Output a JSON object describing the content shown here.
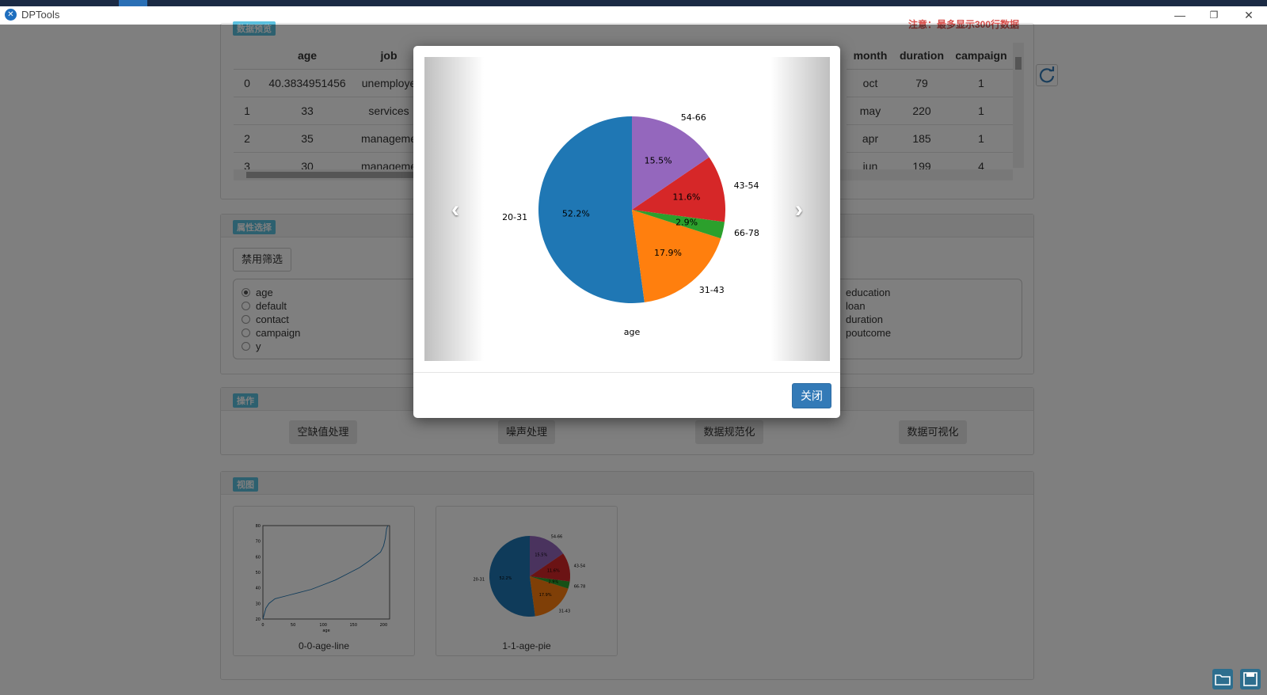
{
  "window": {
    "title": "DPTools",
    "minimize": "—",
    "restore": "❐",
    "close": "✕"
  },
  "table_panel": {
    "tag": "数据预览",
    "note": "注意：最多显示300行数据",
    "left_columns": [
      "",
      "age",
      "job"
    ],
    "right_columns": [
      "month",
      "duration",
      "campaign"
    ],
    "rows": [
      {
        "idx": "0",
        "age": "40.3834951456",
        "job": "unemploye",
        "month": "oct",
        "duration": "79",
        "campaign": "1"
      },
      {
        "idx": "1",
        "age": "33",
        "job": "services",
        "month": "may",
        "duration": "220",
        "campaign": "1"
      },
      {
        "idx": "2",
        "age": "35",
        "job": "manageme",
        "month": "apr",
        "duration": "185",
        "campaign": "1"
      },
      {
        "idx": "3",
        "age": "30",
        "job": "manageme",
        "month": "jun",
        "duration": "199",
        "campaign": "4"
      }
    ]
  },
  "attr_panel": {
    "tag": "属性选择",
    "filter_button": "禁用筛选",
    "left_options": [
      "age",
      "default",
      "contact",
      "campaign",
      "y"
    ],
    "right_options": [
      "education",
      "loan",
      "duration",
      "poutcome"
    ],
    "selected": "age"
  },
  "ops_panel": {
    "tag": "操作",
    "buttons": [
      "空缺值处理",
      "噪声处理",
      "数据规范化",
      "数据可视化"
    ]
  },
  "view_panel": {
    "tag": "视图",
    "thumbs": [
      {
        "caption": "0-0-age-line"
      },
      {
        "caption": "1-1-age-pie"
      }
    ]
  },
  "modal": {
    "close_label": "关闭",
    "prev_icon": "chevron-left-icon",
    "next_icon": "chevron-right-icon"
  },
  "chart_data": [
    {
      "type": "pie",
      "title": "",
      "xlabel": "age",
      "categories": [
        "20-31",
        "31-43",
        "66-78",
        "43-54",
        "54-66"
      ],
      "values": [
        52.2,
        17.9,
        2.9,
        11.6,
        15.5
      ],
      "labels": [
        "52.2%",
        "17.9%",
        "2.9%",
        "11.6%",
        "15.5%"
      ],
      "colors": [
        "#1f77b4",
        "#ff7f0e",
        "#2ca02c",
        "#d62728",
        "#9467bd"
      ]
    },
    {
      "type": "line",
      "xlabel": "age",
      "xlim": [
        0,
        210
      ],
      "ylim": [
        20,
        80
      ],
      "xticks": [
        "0",
        "50",
        "100",
        "150",
        "200"
      ],
      "yticks": [
        "20",
        "30",
        "40",
        "50",
        "60",
        "70",
        "80"
      ],
      "x": [
        0,
        5,
        10,
        20,
        40,
        60,
        80,
        100,
        120,
        140,
        160,
        175,
        185,
        195,
        200,
        203,
        205,
        207
      ],
      "y": [
        20,
        27,
        30,
        33,
        35,
        37,
        39,
        42,
        45,
        49,
        53,
        57,
        60,
        63,
        67,
        72,
        78,
        80
      ],
      "color": "#1f77b4"
    }
  ]
}
